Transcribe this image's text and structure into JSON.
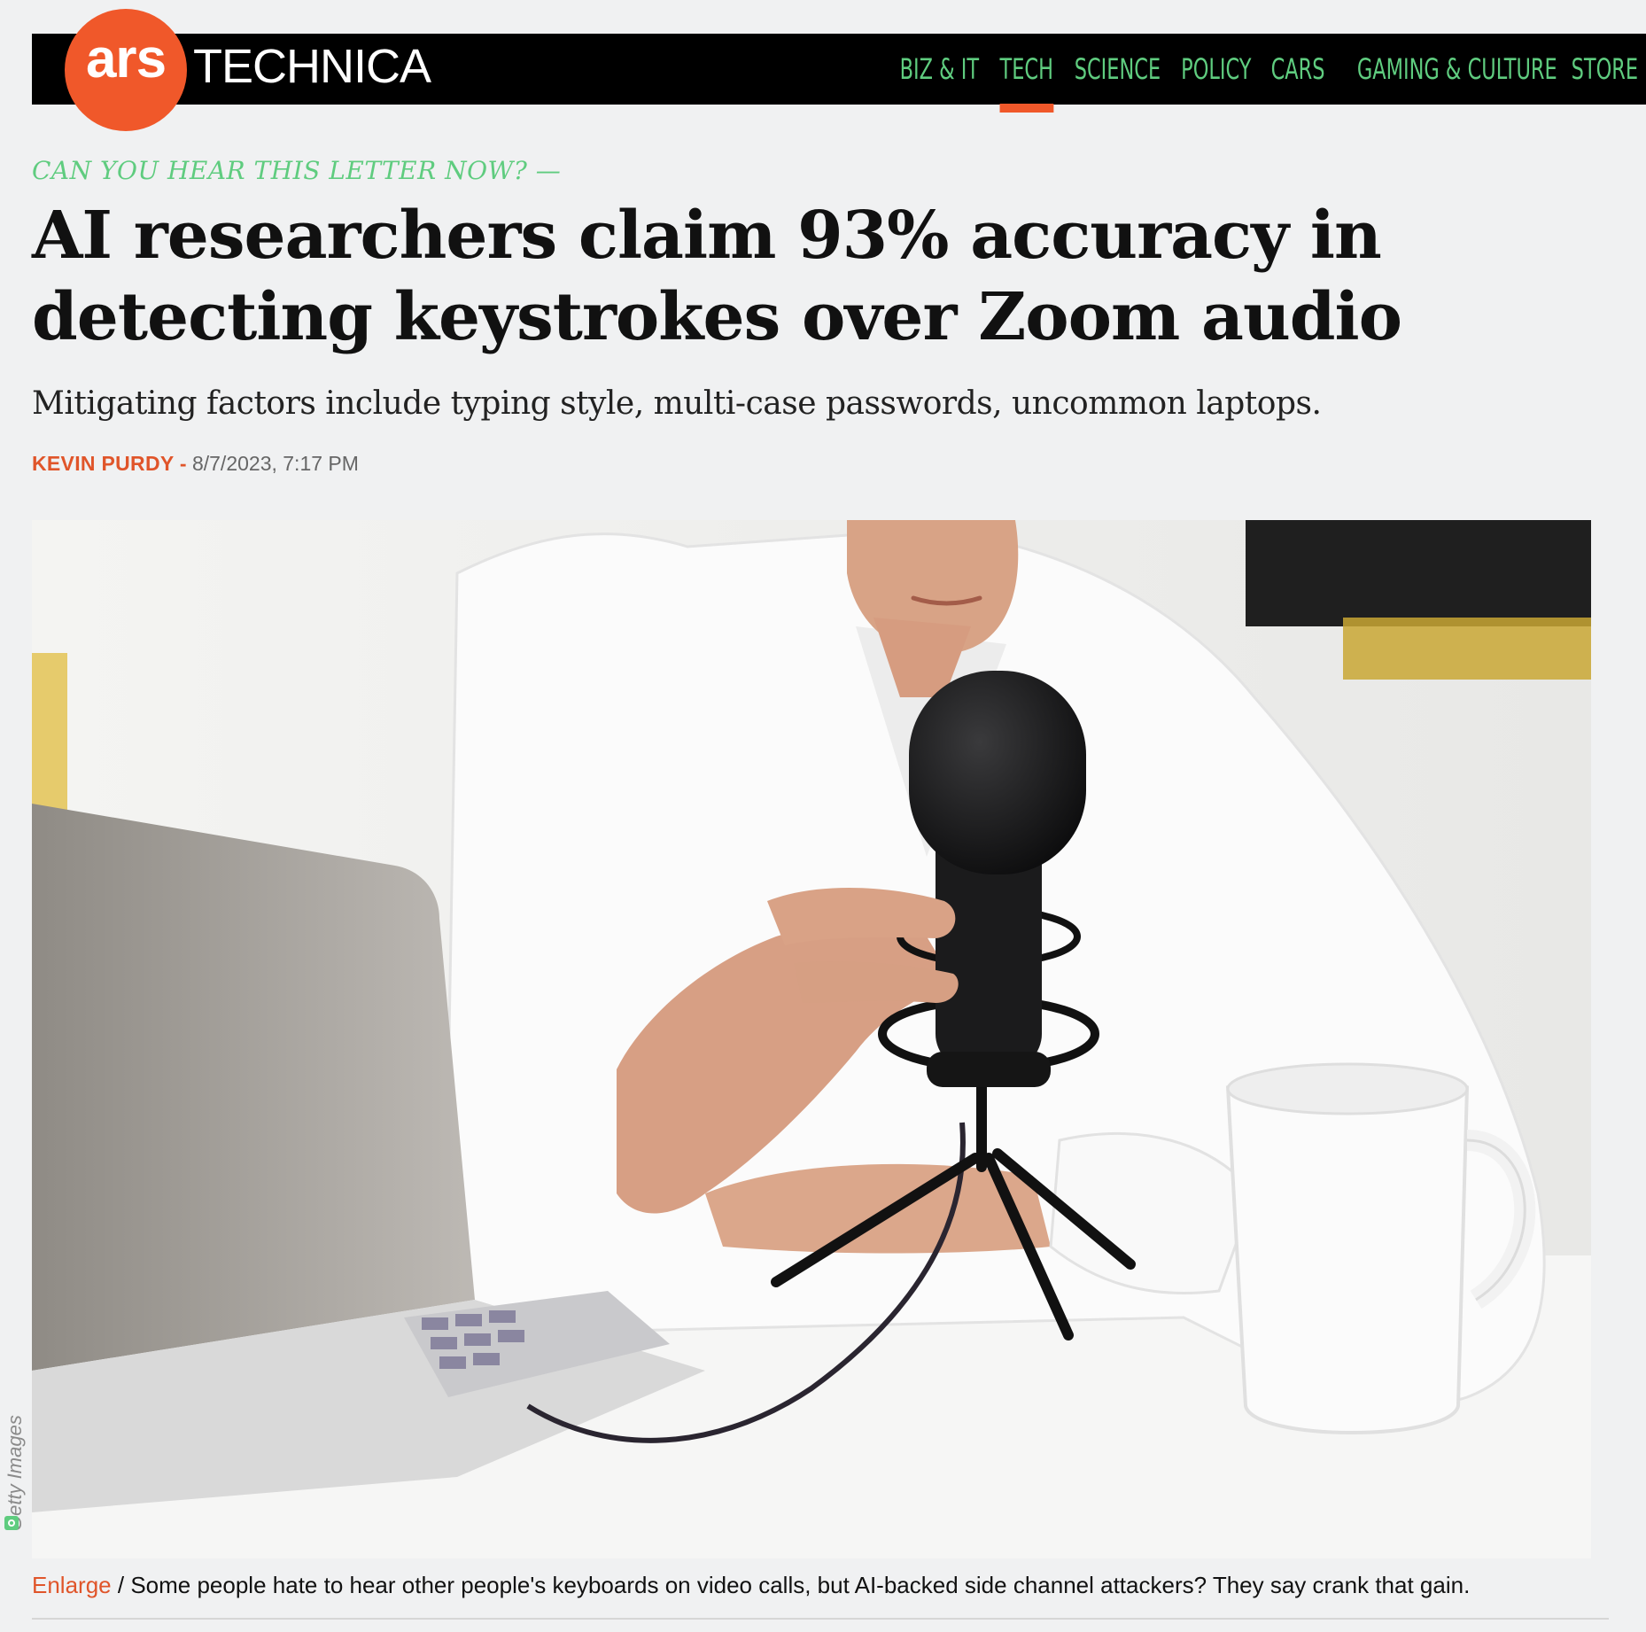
{
  "header": {
    "logo_ars": "ars",
    "logo_technica": "TECHNICA",
    "nav": [
      {
        "label": "BIZ & IT"
      },
      {
        "label": "TECH"
      },
      {
        "label": "SCIENCE"
      },
      {
        "label": "POLICY"
      },
      {
        "label": "CARS"
      },
      {
        "label": "GAMING & CULTURE"
      },
      {
        "label": "STORE"
      }
    ],
    "active_nav": "TECH"
  },
  "article": {
    "kicker": "CAN YOU HEAR THIS LETTER NOW? —",
    "headline": "AI researchers claim 93% accuracy in detecting keystrokes over Zoom audio",
    "dek": "Mitigating factors include typing style, multi-case passwords, uncommon laptops.",
    "author": "KEVIN PURDY",
    "byline_separator": "-",
    "date": "8/7/2023, 7:17 PM"
  },
  "image": {
    "credit": "Getty Images",
    "icon": "camera-icon"
  },
  "caption": {
    "enlarge_label": "Enlarge",
    "separator": "/",
    "text": "Some people hate to hear other people's keyboards on video calls, but AI-backed side channel attackers? They say crank that gain."
  },
  "colors": {
    "brand_orange": "#f0582a",
    "nav_green": "#5fcc7f",
    "background": "#f0f1f2"
  }
}
